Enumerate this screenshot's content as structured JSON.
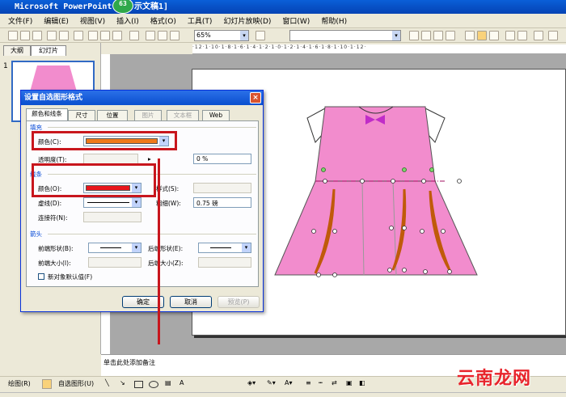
{
  "window": {
    "title": "Microsoft PowerPoint",
    "title_suffix": "示文稿1]",
    "badge": "63"
  },
  "menu": [
    "文件(F)",
    "编辑(E)",
    "视图(V)",
    "插入(I)",
    "格式(O)",
    "工具(T)",
    "幻灯片放映(D)",
    "窗口(W)",
    "帮助(H)"
  ],
  "toolbar": {
    "zoom": "65%"
  },
  "left_pane": {
    "tabs": [
      "大纲",
      "幻灯片"
    ],
    "slide_number": "1"
  },
  "notes": {
    "placeholder": "单击此处添加备注"
  },
  "drawbar": {
    "draw_label": "绘图(R)",
    "autoshape_label": "自选图形(U)"
  },
  "dialog": {
    "title": "设置自选图形格式",
    "close": "×",
    "tabs": [
      "颜色和线条",
      "尺寸",
      "位置",
      "图片",
      "文本框",
      "Web"
    ],
    "fill": {
      "group": "填充",
      "color_label": "颜色(C):",
      "color_value": "#f07a1a",
      "transparency_label": "透明度(T):",
      "transparency_value": "0 %"
    },
    "line": {
      "group": "线条",
      "color_label": "颜色(O):",
      "color_value": "#e8161c",
      "style_label": "样式(S):",
      "dash_label": "虚线(D):",
      "weight_label": "粗细(W):",
      "weight_value": "0.75 磅",
      "connector_label": "连接符(N):"
    },
    "arrows": {
      "group": "箭头",
      "begin_style_label": "前端形状(B):",
      "end_style_label": "后端形状(E):",
      "begin_size_label": "前端大小(I):",
      "end_size_label": "后端大小(Z):"
    },
    "default_checkbox": "新对象默认值(F)",
    "buttons": {
      "ok": "确定",
      "cancel": "取消",
      "preview": "预览(P)"
    }
  },
  "colors": {
    "dress_pink": "#f28ccd",
    "dress_orange": "#f47c14",
    "bow": "#c02cc8",
    "highlight_red": "#c8161d",
    "watermark": "#e8242c"
  },
  "watermark": "云南龙网"
}
